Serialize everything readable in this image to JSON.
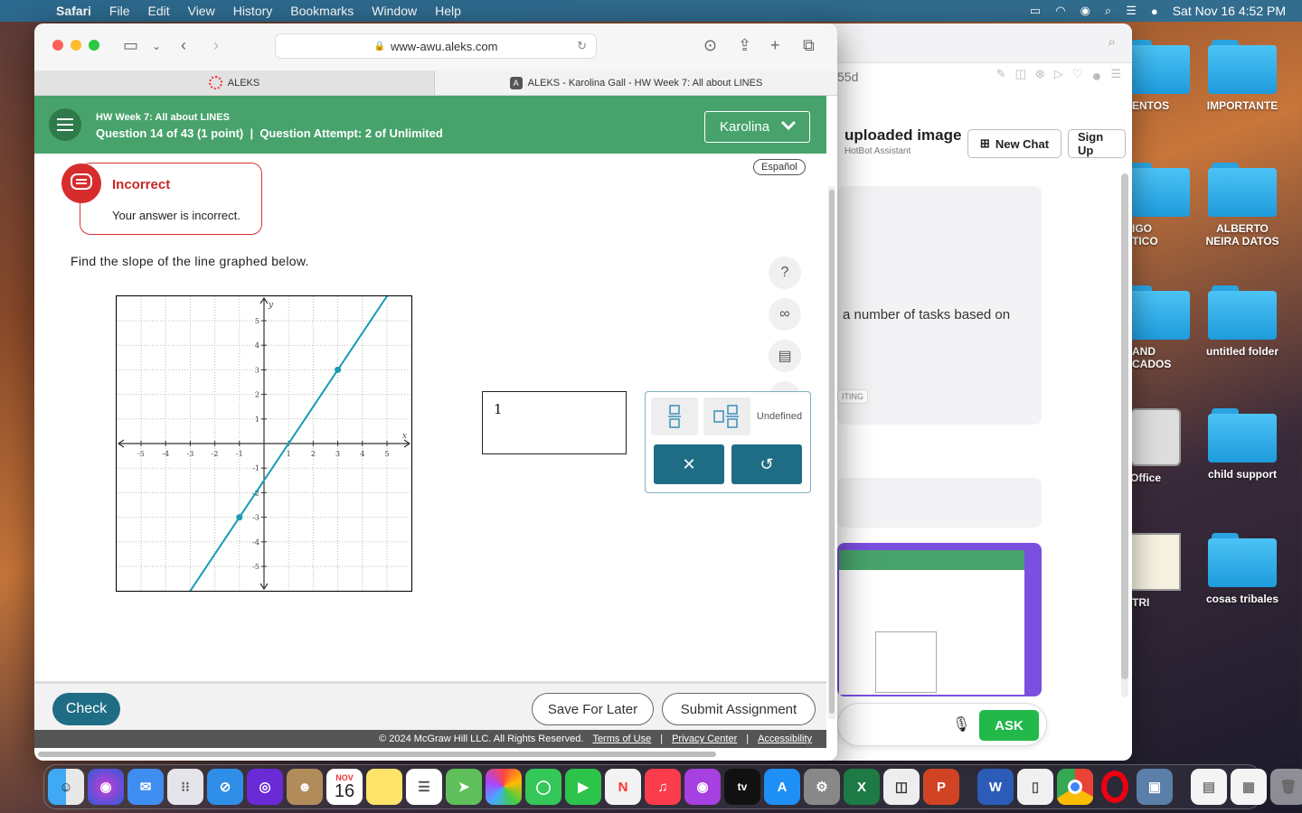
{
  "menubar": {
    "app": "Safari",
    "items": [
      "File",
      "Edit",
      "View",
      "History",
      "Bookmarks",
      "Window",
      "Help"
    ],
    "datetime": "Sat Nov 16  4:52 PM"
  },
  "desktop": {
    "items": [
      {
        "label": "ENTOS"
      },
      {
        "label": "IMPORTANTE"
      },
      {
        "label": "IGO\nTICO"
      },
      {
        "label": "ALBERTO NEIRA DATOS"
      },
      {
        "label": "AND\nCADOS"
      },
      {
        "label": "untitled folder"
      },
      {
        "label": "Office"
      },
      {
        "label": "child support"
      },
      {
        "label": "TRI"
      },
      {
        "label": "cosas tribales"
      }
    ]
  },
  "hotbot": {
    "row_text": "55d",
    "title": "uploaded image",
    "subtitle": "HotBot Assistant",
    "new_chat": "New Chat",
    "sign_up": "Sign Up",
    "message": "a number of tasks based on",
    "tag": "ITING",
    "ask": "ASK"
  },
  "browser": {
    "url": "www-awu.aleks.com",
    "tabs": [
      {
        "label": "ALEKS"
      },
      {
        "label": "ALEKS - Karolina Gall - HW Week 7: All about LINES"
      }
    ]
  },
  "aleks": {
    "title": "HW Week 7: All about LINES",
    "subtitle": "Question 14 of 43 (1 point)  |  Question Attempt: 2 of Unlimited",
    "user": "Karolina",
    "espanol": "Español",
    "feedback_title": "Incorrect",
    "feedback_text": "Your answer is incorrect.",
    "question": "Find the slope of the line graphed below.",
    "answer_value": "1",
    "keypad": {
      "undefined_label": "Undefined"
    },
    "buttons": {
      "check": "Check",
      "save": "Save For Later",
      "submit": "Submit Assignment"
    },
    "footer": {
      "copyright": "© 2024 McGraw Hill LLC. All Rights Reserved.",
      "terms": "Terms of Use",
      "privacy": "Privacy Center",
      "accessibility": "Accessibility"
    },
    "graph": {
      "x_label": "x",
      "y_label": "y",
      "x_ticks": [
        -5,
        -4,
        -3,
        -2,
        -1,
        1,
        2,
        3,
        4,
        5
      ],
      "y_ticks": [
        5,
        4,
        3,
        2,
        1,
        -1,
        -2,
        -3,
        -4,
        -5
      ],
      "points": [
        {
          "x": -1,
          "y": -3
        },
        {
          "x": 3,
          "y": 3
        }
      ],
      "line_color": "#1a9bb0"
    }
  },
  "dock": {
    "calendar_month": "NOV",
    "calendar_day": "16"
  }
}
